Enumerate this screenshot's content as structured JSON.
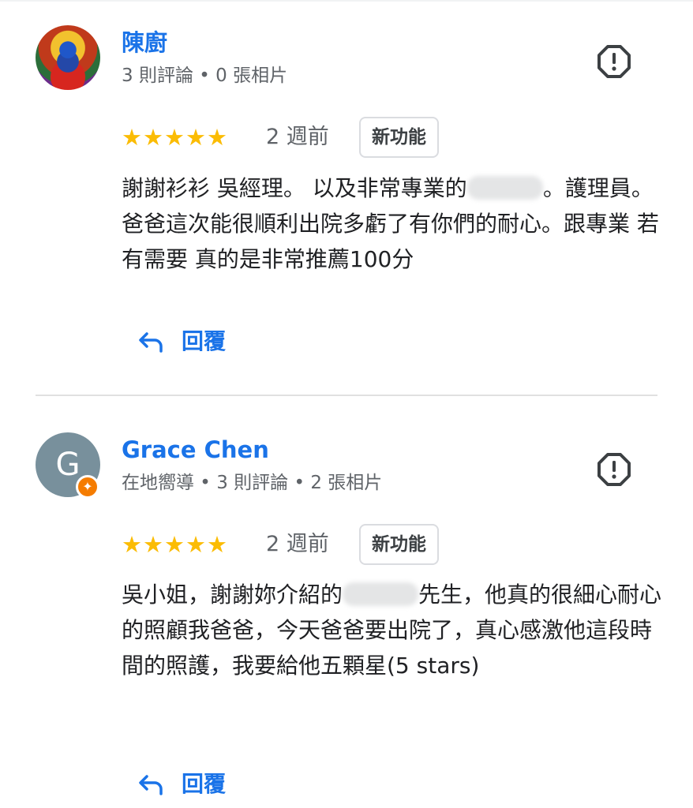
{
  "reviews": [
    {
      "name": "陳廚",
      "meta": "3 則評論 • 0 張相片",
      "rating": 5,
      "date": "2 週前",
      "new_label": "新功能",
      "text_before": "謝謝衫衫 吳經理。 以及非常專業的",
      "text_after": "。護理員。 爸爸這次能很順利出院多虧了有你們的耐心。跟專業 若有需要 真的是非常推薦100分",
      "reply_label": "回覆",
      "avatar_icon": "buddha-avatar-photo"
    },
    {
      "name": "Grace Chen",
      "avatar_letter": "G",
      "badge_icon": "local-guide-badge-icon",
      "meta": "在地嚮導 • 3 則評論 • 2 張相片",
      "rating": 5,
      "date": "2 週前",
      "new_label": "新功能",
      "text_before": "吳小姐，謝謝妳介紹的",
      "text_after": "先生，他真的很細心耐心的照顧我爸爸，今天爸爸要出院了，真心感激他這段時間的照護，我要給他五顆星(5 stars)",
      "reply_label": "回覆"
    }
  ],
  "colors": {
    "link": "#1a73e8",
    "star": "#fbbc04",
    "badge": "#f57c00",
    "avatar_bg": "#78909c"
  }
}
